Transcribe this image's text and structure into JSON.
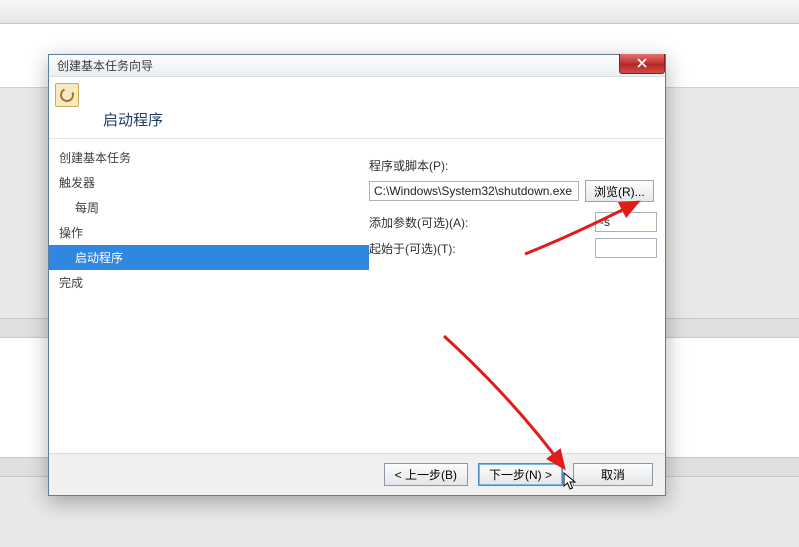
{
  "dialog": {
    "title": "创建基本任务向导",
    "header": "启动程序"
  },
  "sidebar": {
    "items": [
      {
        "label": "创建基本任务",
        "sub": false
      },
      {
        "label": "触发器",
        "sub": false
      },
      {
        "label": "每周",
        "sub": true
      },
      {
        "label": "操作",
        "sub": false
      },
      {
        "label": "启动程序",
        "sub": true,
        "selected": true
      },
      {
        "label": "完成",
        "sub": false
      }
    ]
  },
  "form": {
    "script_label": "程序或脚本(P):",
    "script_value": "C:\\Windows\\System32\\shutdown.exe",
    "browse_label": "浏览(R)...",
    "args_label": "添加参数(可选)(A):",
    "args_value": "-s",
    "startin_label": "起始于(可选)(T):",
    "startin_value": ""
  },
  "footer": {
    "back": "< 上一步(B)",
    "next": "下一步(N) >",
    "cancel": "取消"
  }
}
